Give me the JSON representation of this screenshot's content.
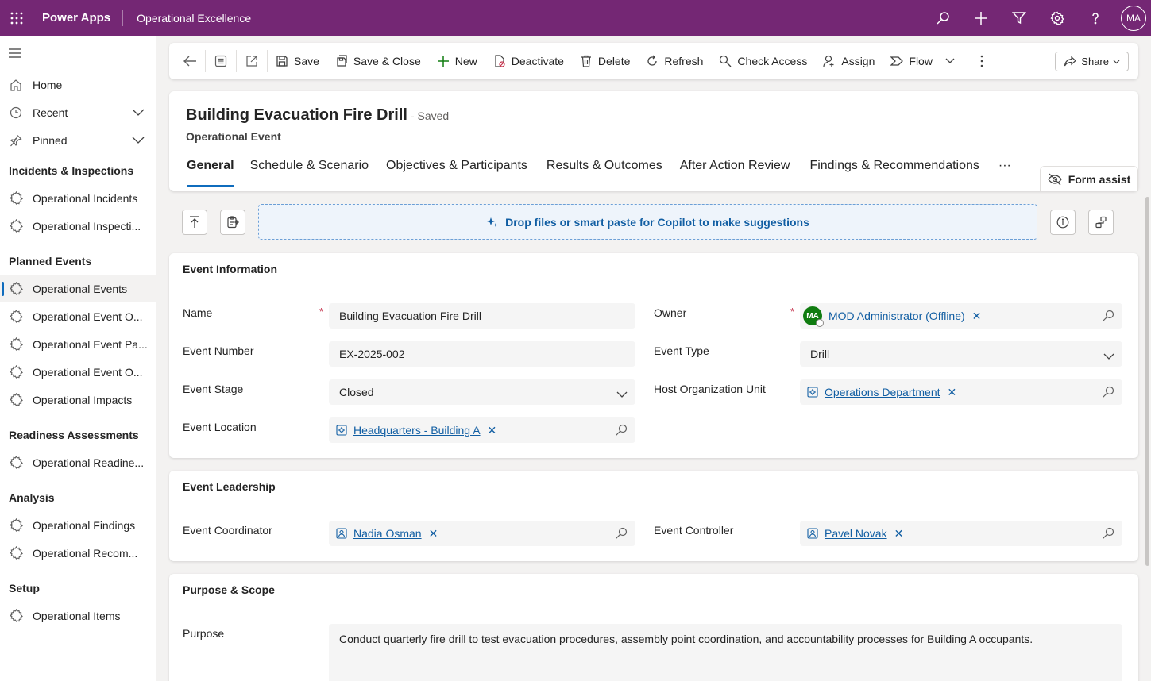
{
  "topbar": {
    "app_name": "Power Apps",
    "environment": "Operational Excellence",
    "user_initials": "MA",
    "icons": [
      "search-icon",
      "plus-icon",
      "filter-icon",
      "settings-icon",
      "help-icon"
    ]
  },
  "sidebar": {
    "home": "Home",
    "recent": "Recent",
    "pinned": "Pinned",
    "groups": [
      {
        "title": "Incidents & Inspections",
        "items": [
          "Operational Incidents",
          "Operational Inspecti..."
        ]
      },
      {
        "title": "Planned Events",
        "items": [
          "Operational Events",
          "Operational Event O...",
          "Operational Event Pa...",
          "Operational Event O...",
          "Operational Impacts"
        ]
      },
      {
        "title": "Readiness Assessments",
        "items": [
          "Operational Readine..."
        ]
      },
      {
        "title": "Analysis",
        "items": [
          "Operational Findings",
          "Operational Recom..."
        ]
      },
      {
        "title": "Setup",
        "items": [
          "Operational Items"
        ]
      }
    ]
  },
  "commandbar": {
    "save": "Save",
    "save_close": "Save & Close",
    "new": "New",
    "deactivate": "Deactivate",
    "delete": "Delete",
    "refresh": "Refresh",
    "check_access": "Check Access",
    "assign": "Assign",
    "flow": "Flow",
    "share": "Share"
  },
  "record": {
    "title": "Building Evacuation Fire Drill",
    "saved_status": "- Saved",
    "entity": "Operational Event",
    "tabs": [
      "General",
      "Schedule & Scenario",
      "Objectives & Participants",
      "Results & Outcomes",
      "After Action Review",
      "Findings & Recommendations"
    ],
    "more_tabs": "···",
    "form_assist": "Form assist"
  },
  "copilot": {
    "dropzone_text": "Drop files or smart paste for Copilot to make suggestions"
  },
  "event_information": {
    "title": "Event Information",
    "name_label": "Name",
    "name_value": "Building Evacuation Fire Drill",
    "owner_label": "Owner",
    "owner_initials": "MA",
    "owner_value": "MOD Administrator (Offline)",
    "event_number_label": "Event Number",
    "event_number_value": "EX-2025-002",
    "event_type_label": "Event Type",
    "event_type_value": "Drill",
    "event_stage_label": "Event Stage",
    "event_stage_value": "Closed",
    "host_org_label": "Host Organization Unit",
    "host_org_value": "Operations Department",
    "event_location_label": "Event Location",
    "event_location_value": "Headquarters - Building A",
    "required_marker": "*"
  },
  "event_leadership": {
    "title": "Event Leadership",
    "coordinator_label": "Event Coordinator",
    "coordinator_value": "Nadia Osman",
    "controller_label": "Event Controller",
    "controller_value": "Pavel Novak"
  },
  "purpose_scope": {
    "title": "Purpose & Scope",
    "purpose_label": "Purpose",
    "purpose_value": "Conduct quarterly fire drill to test evacuation procedures, assembly point coordination, and accountability processes for Building A occupants."
  }
}
